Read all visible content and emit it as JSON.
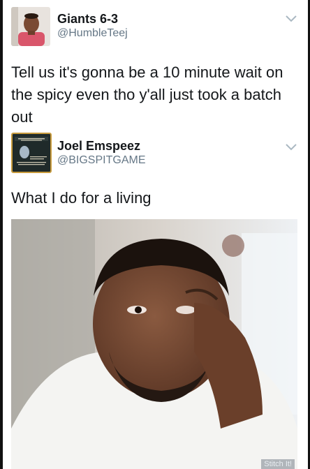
{
  "tweets": [
    {
      "display_name": "Giants 6-3",
      "handle": "@HumbleTeej",
      "text": "Tell us it's gonna be a 10 minute wait on the spicy even tho y'all just took a batch out",
      "icon": "chevron-down-icon"
    },
    {
      "display_name": "Joel Emspeez",
      "handle": "@BIGSPITGAME",
      "text": "What I do for a living",
      "icon": "chevron-down-icon",
      "photo_watermark": "Stitch It!"
    }
  ],
  "colors": {
    "text": "#14171a",
    "handle": "#657786",
    "chevron": "#aab8c2"
  }
}
